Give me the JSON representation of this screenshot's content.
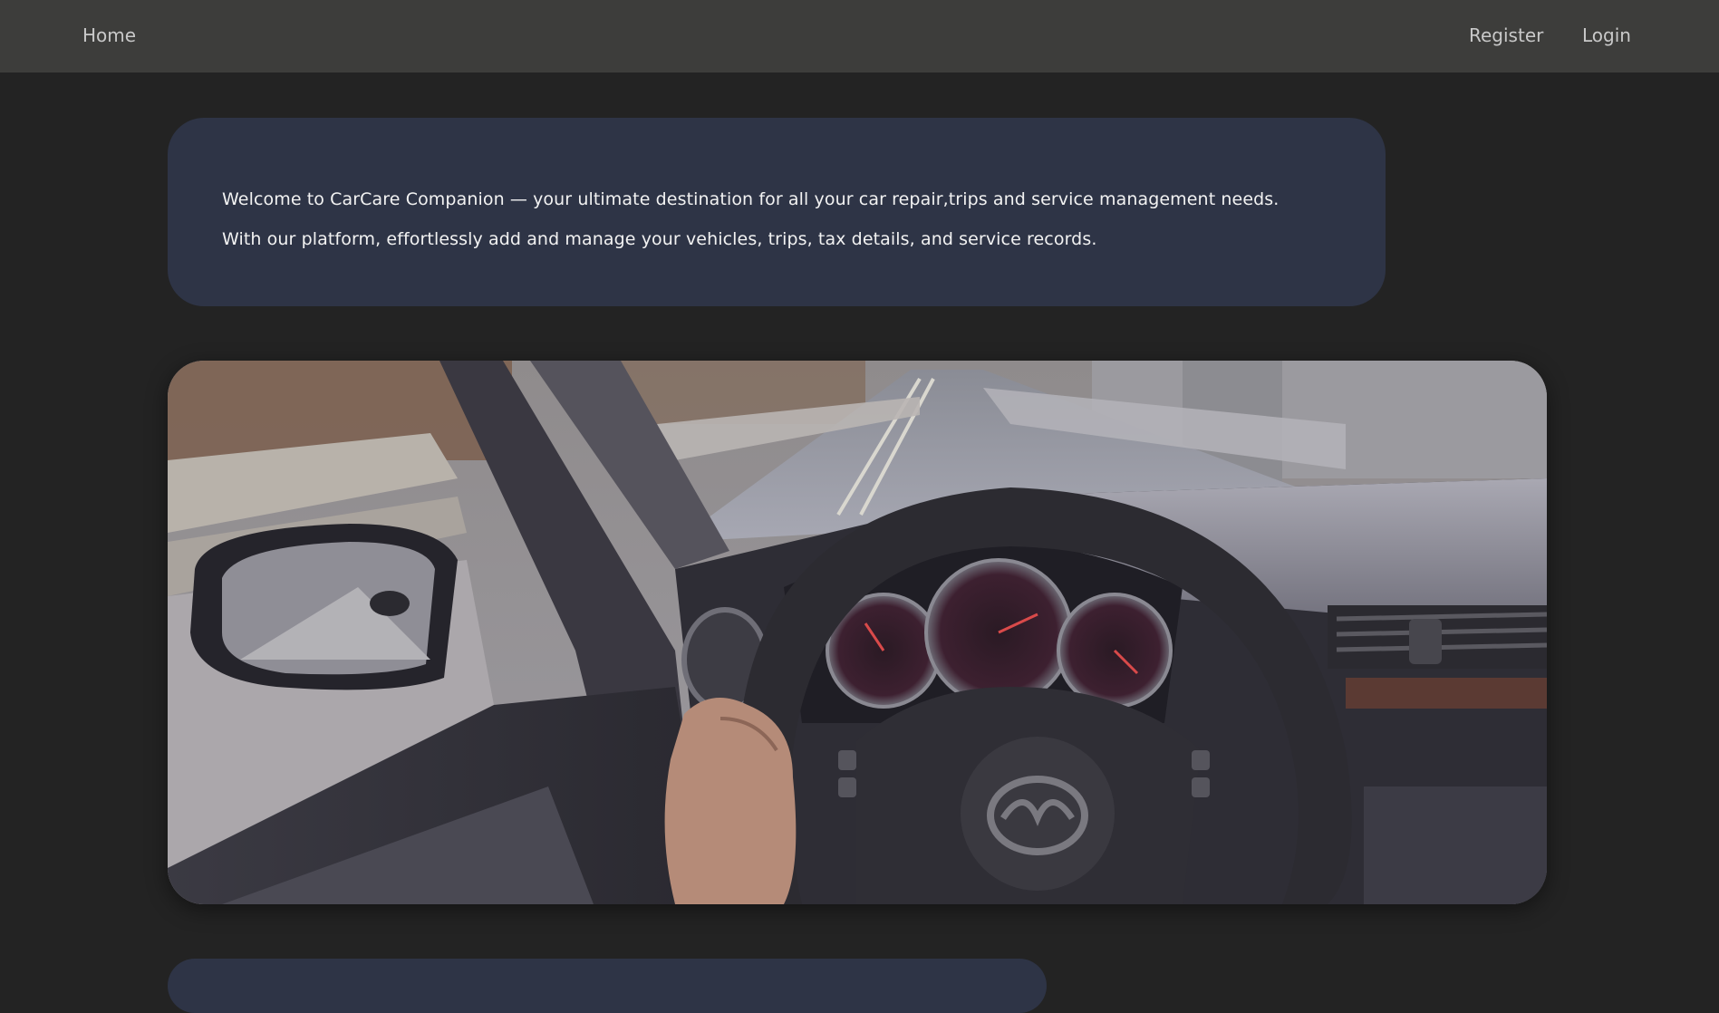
{
  "nav": {
    "home": "Home",
    "register": "Register",
    "login": "Login"
  },
  "welcome": {
    "line1": "Welcome to CarCare Companion — your ultimate destination for all your car repair,trips and service management needs.",
    "line2": "With our platform, effortlessly add and manage your vehicles, trips, tax details, and service records."
  },
  "hero": {
    "image": "driver-pov-steering-wheel-image"
  },
  "colors": {
    "page_bg": "#232323",
    "navbar_bg": "#3d3d3b",
    "card_bg": "#2e3446",
    "nav_text": "#c9c9c9",
    "card_text": "#f2f2f2"
  }
}
